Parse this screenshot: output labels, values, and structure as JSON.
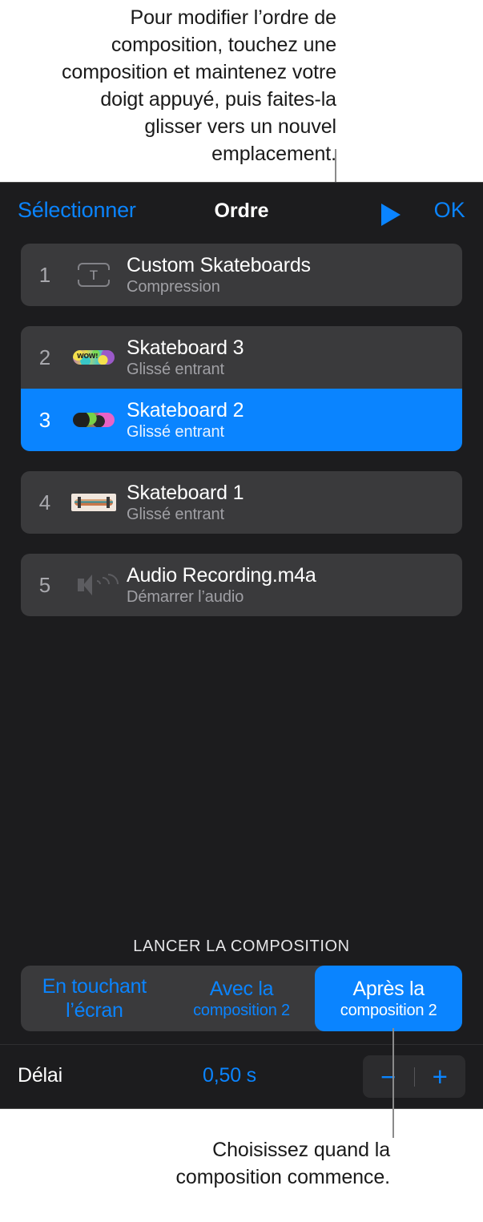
{
  "callouts": {
    "top": "Pour modifier l’ordre de composition, touchez une composition et maintenez votre doigt appuyé, puis faites-la glisser vers un nouvel emplacement.",
    "bottom": "Choisissez quand la composition commence."
  },
  "header": {
    "select_label": "Sélectionner",
    "title": "Ordre",
    "play_icon": "play-triangle-icon",
    "done_label": "OK"
  },
  "list": {
    "rows": [
      {
        "index": "1",
        "title": "Custom Skateboards",
        "subtitle": "Compression",
        "icon": "text-placeholder-icon",
        "selected": false
      },
      {
        "index": "2",
        "title": "Skateboard 3",
        "subtitle": "Glissé entrant",
        "icon": "skateboard-wow-thumbnail",
        "selected": false
      },
      {
        "index": "3",
        "title": "Skateboard 2",
        "subtitle": "Glissé entrant",
        "icon": "skateboard-2-thumbnail",
        "selected": true
      },
      {
        "index": "4",
        "title": "Skateboard 1",
        "subtitle": "Glissé entrant",
        "icon": "skateboard-1-thumbnail",
        "selected": false
      },
      {
        "index": "5",
        "title": "Audio Recording.m4a",
        "subtitle": "Démarrer l’audio",
        "icon": "speaker-icon",
        "selected": false
      }
    ]
  },
  "start_section": {
    "header": "LANCER LA COMPOSITION",
    "options": [
      {
        "line1": "En touchant",
        "line2": "l’écran",
        "active": false
      },
      {
        "line1": "Avec la",
        "line2": "composition 2",
        "active": false
      },
      {
        "line1": "Après la",
        "line2": "composition 2",
        "active": true
      }
    ]
  },
  "delay": {
    "label": "Délai",
    "value": "0,50 s",
    "minus_label": "−",
    "plus_label": "+"
  },
  "colors": {
    "accent": "#0a84ff",
    "panel_bg": "#1c1c1e",
    "row_bg": "#3a3a3c",
    "text_primary": "#ffffff",
    "text_secondary": "#a0a0a5"
  }
}
